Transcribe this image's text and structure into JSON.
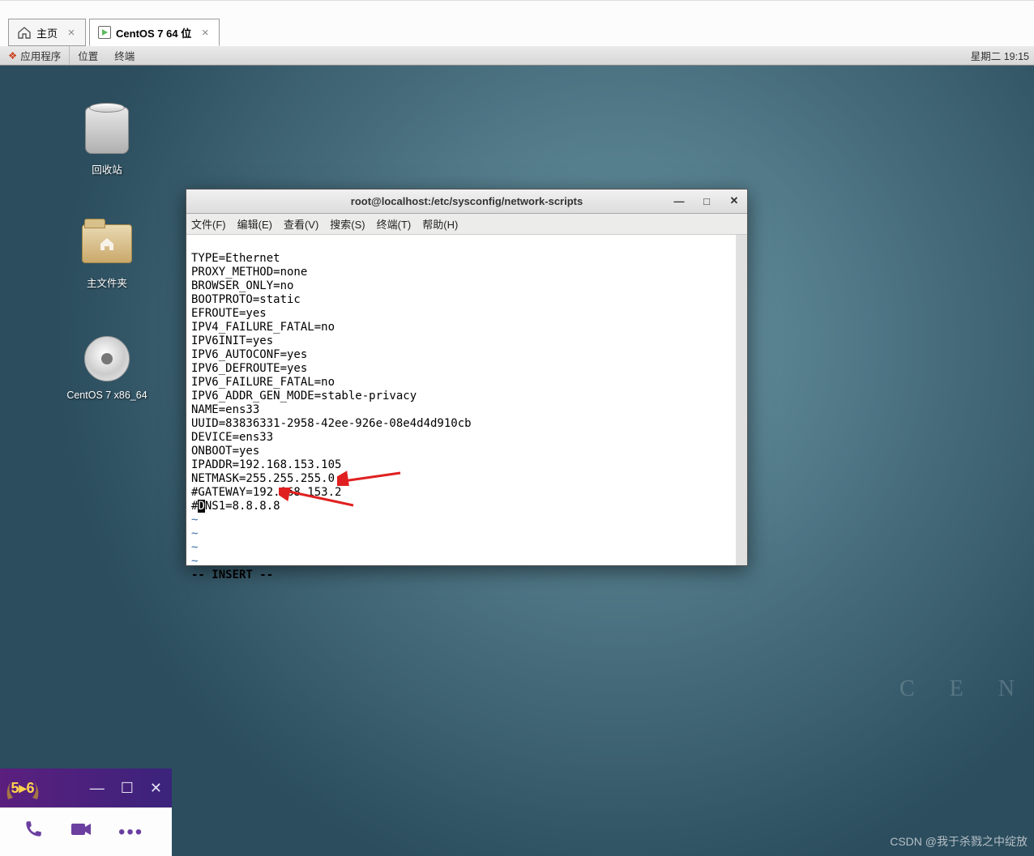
{
  "vmware": {
    "tabs": [
      {
        "label": "主页"
      },
      {
        "label": "CentOS 7 64 位"
      }
    ]
  },
  "gnome": {
    "applications": "应用程序",
    "places": "位置",
    "terminal": "终端",
    "datetime": "星期二 19:15"
  },
  "desktop_icons": {
    "trash": "回收站",
    "home": "主文件夹",
    "disc": "CentOS 7 x86_64"
  },
  "desktop_watermark": "C E N",
  "terminal": {
    "title": "root@localhost:/etc/sysconfig/network-scripts",
    "menu": {
      "file": "文件(F)",
      "edit": "编辑(E)",
      "view": "查看(V)",
      "search": "搜索(S)",
      "terminal": "终端(T)",
      "help": "帮助(H)"
    },
    "lines": [
      "TYPE=Ethernet",
      "PROXY_METHOD=none",
      "BROWSER_ONLY=no",
      "BOOTPROTO=static",
      "EFROUTE=yes",
      "IPV4_FAILURE_FATAL=no",
      "IPV6INIT=yes",
      "IPV6_AUTOCONF=yes",
      "IPV6_DEFROUTE=yes",
      "IPV6_FAILURE_FATAL=no",
      "IPV6_ADDR_GEN_MODE=stable-privacy",
      "NAME=ens33",
      "UUID=83836331-2958-42ee-926e-08e4d4d910cb",
      "DEVICE=ens33",
      "ONBOOT=yes",
      "IPADDR=192.168.153.105",
      "NETMASK=255.255.255.0",
      "#GATEWAY=192.168.153.2"
    ],
    "dns_prefix": "#",
    "dns_cursor": "D",
    "dns_suffix": "NS1=8.8.8.8",
    "tilde": "~",
    "status": "-- INSERT --"
  },
  "discord_bar": {
    "level": "5▸6"
  },
  "csdn_watermark": "CSDN @我于杀戮之中绽放"
}
